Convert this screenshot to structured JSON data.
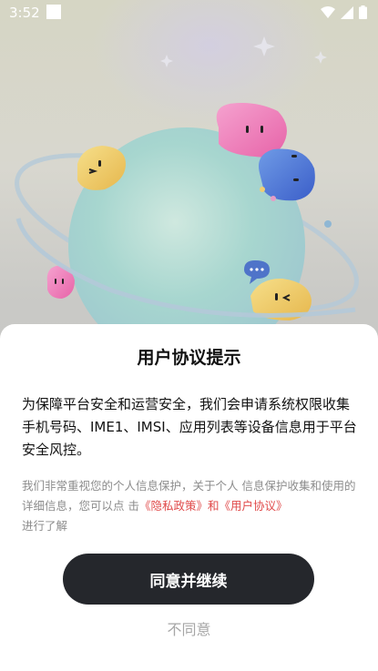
{
  "status_bar": {
    "time": "3:52",
    "icons": [
      "wifi-icon",
      "cellular-signal-icon",
      "battery-icon"
    ]
  },
  "dialog": {
    "title": "用户协议提示",
    "main_text": "为保障平台安全和运营安全，我们会申请系统权限收集手机号码、IME1、IMSI、应用列表等设备信息用于平台安全风控。",
    "privacy_text_before": "我们非常重视您的个人信息保护，关于个人 信息保护收集和使用的详细信息，您可以点 击",
    "privacy_policy_link": "《隐私政策》",
    "conjunction": "和",
    "user_agreement_link": "《用户协议》",
    "privacy_text_after": "进行了解",
    "agree_button": "同意并继续",
    "disagree_button": "不同意"
  },
  "colors": {
    "accent_link": "#e04a4a",
    "primary_button": "#25272c",
    "secondary_text": "#8c8c8c"
  }
}
